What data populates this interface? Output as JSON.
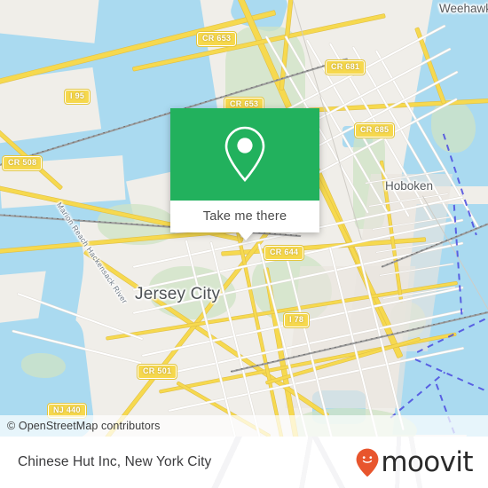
{
  "map": {
    "attribution": "© OpenStreetMap contributors",
    "places": [
      {
        "name": "Jersey City",
        "type": "city"
      },
      {
        "name": "Hoboken",
        "type": "town"
      },
      {
        "name": "Weehawken",
        "type": "town"
      },
      {
        "name": "Marion Reach Hackensack River",
        "type": "river"
      }
    ],
    "road_shields": [
      {
        "label": "CR 653"
      },
      {
        "label": "CR 681"
      },
      {
        "label": "CR 653"
      },
      {
        "label": "CR 685"
      },
      {
        "label": "I 95"
      },
      {
        "label": "CR 508"
      },
      {
        "label": "CR 644"
      },
      {
        "label": "I 78"
      },
      {
        "label": "CR 501"
      },
      {
        "label": "NJ 440"
      }
    ],
    "colors": {
      "water": "#aadaf0",
      "land": "#f0eee9",
      "park": "#cfe3c4",
      "road": "#f6d94f"
    }
  },
  "popup": {
    "pin_icon": "map-pin-icon",
    "cta_label": "Take me there",
    "accent_color": "#22b15d"
  },
  "bottom_bar": {
    "title": "Chinese Hut Inc, New York City",
    "brand_name": "moovit",
    "brand_icon": "moovit-smiley-pin-icon",
    "brand_color": "#e8552d"
  }
}
